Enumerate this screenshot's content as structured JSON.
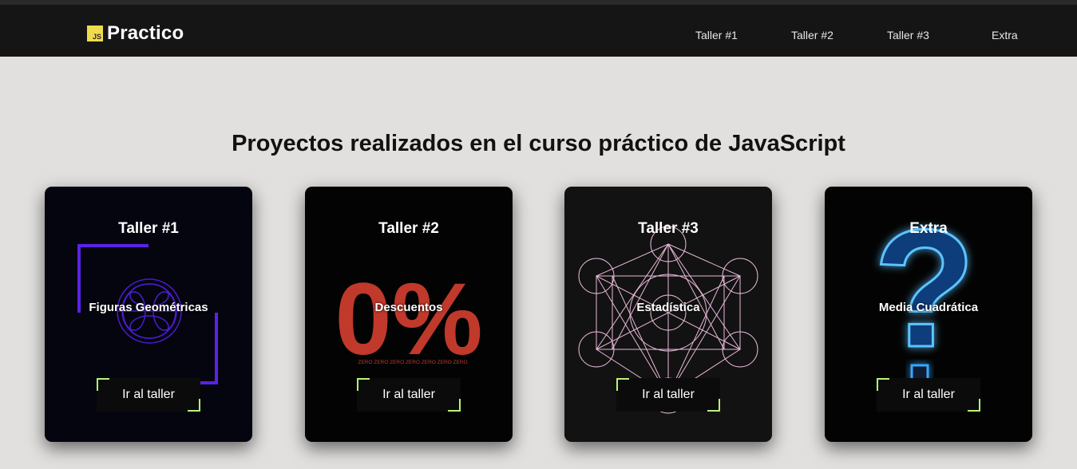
{
  "header": {
    "logo_badge": "JS",
    "logo_text": "Practico",
    "nav": [
      "Taller #1",
      "Taller #2",
      "Taller #3",
      "Extra"
    ]
  },
  "main": {
    "heading": "Proyectos realizados en el curso práctico de JavaScript",
    "cards": [
      {
        "title": "Taller #1",
        "subtitle": "Figuras Geométricas",
        "button": "Ir al taller",
        "background": "#050510",
        "accent": "#5a22e6"
      },
      {
        "title": "Taller #2",
        "subtitle": "Descuentos",
        "button": "Ir al taller",
        "background": "#030303",
        "accent": "#c0392b",
        "art_text": "0%",
        "art_caption": "ZERO ZERO ZERO ZERO ZERO ZERO ZERO"
      },
      {
        "title": "Taller #3",
        "subtitle": "Estadística",
        "button": "Ir al taller",
        "background": "#121212",
        "accent": "#e8b9d8"
      },
      {
        "title": "Extra",
        "subtitle": "Media Cuadrática",
        "button": "Ir al taller",
        "background": "#030303",
        "accent": "#36a8ff",
        "art_text": "?"
      }
    ]
  },
  "colors": {
    "topbar": "#151515",
    "page_background": "#e2e0de",
    "js_badge": "#f0db4f",
    "button_corner": "#b8f37a"
  }
}
